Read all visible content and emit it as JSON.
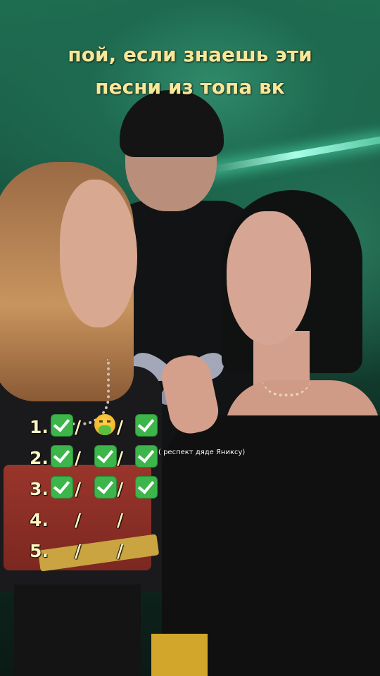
{
  "caption": {
    "line1": "пой, если знаешь эти",
    "line2": "песни из топа вк"
  },
  "list": [
    {
      "number": "1.",
      "marks": [
        "check-icon",
        "nauseated-face-icon",
        "check-icon"
      ]
    },
    {
      "number": "2.",
      "marks": [
        "check-icon",
        "check-icon",
        "check-icon"
      ]
    },
    {
      "number": "3.",
      "marks": [
        "check-icon",
        "check-icon",
        "check-icon"
      ]
    },
    {
      "number": "4.",
      "marks": [
        "",
        "",
        ""
      ]
    },
    {
      "number": "5.",
      "marks": [
        "",
        "",
        ""
      ]
    }
  ],
  "separator": "/",
  "note": "( респект дяде Яниксу)",
  "colors": {
    "caption_text": "#f7e79a",
    "check_green": "#3cb54a",
    "background_green": "#1f6e52"
  }
}
